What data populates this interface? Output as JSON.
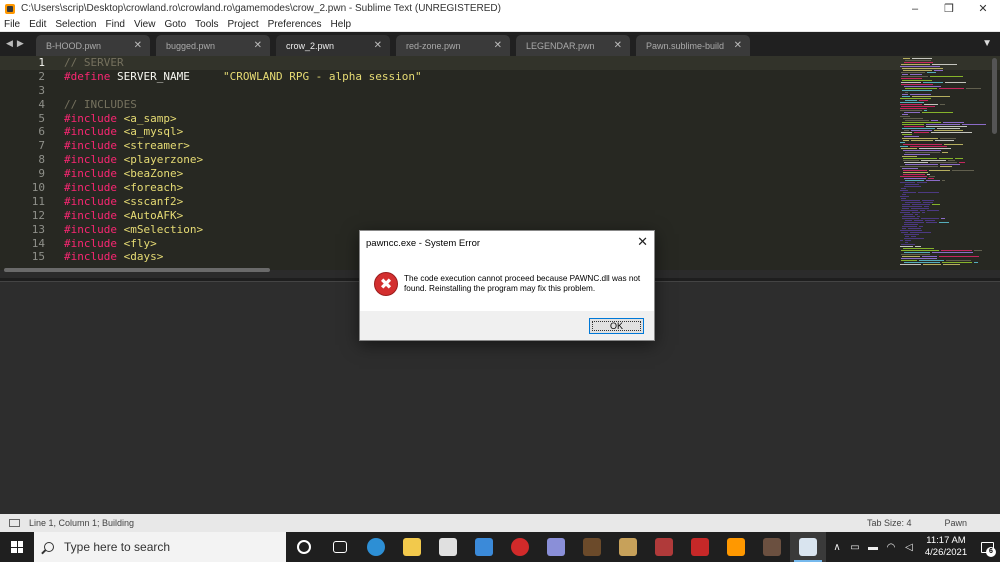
{
  "window": {
    "title": "C:\\Users\\scrip\\Desktop\\crowland.ro\\crowland.ro\\gamemodes\\crow_2.pwn - Sublime Text (UNREGISTERED)",
    "minimize": "–",
    "maximize": "❒",
    "close": "✕"
  },
  "menu": [
    "File",
    "Edit",
    "Selection",
    "Find",
    "View",
    "Goto",
    "Tools",
    "Project",
    "Preferences",
    "Help"
  ],
  "tabs": [
    {
      "label": "B-HOOD.pwn",
      "active": false
    },
    {
      "label": "bugged.pwn",
      "active": false
    },
    {
      "label": "crow_2.pwn",
      "active": true
    },
    {
      "label": "red-zone.pwn",
      "active": false
    },
    {
      "label": "LEGENDAR.pwn",
      "active": false
    },
    {
      "label": "Pawn.sublime-build",
      "active": false
    }
  ],
  "tab_close": "✕",
  "tab_nav": {
    "prev": "◀",
    "next": "▶",
    "dropdown": "▼"
  },
  "editor": {
    "line_numbers": [
      "1",
      "2",
      "3",
      "4",
      "5",
      "6",
      "7",
      "8",
      "9",
      "10",
      "11",
      "12",
      "13",
      "14",
      "15"
    ],
    "lines": [
      {
        "type": "comment",
        "text": "// SERVER"
      },
      {
        "type": "define",
        "kw": "#define",
        "name": " SERVER_NAME",
        "value": "\"CROWLAND RPG - alpha session\""
      },
      {
        "type": "blank",
        "text": ""
      },
      {
        "type": "comment",
        "text": "// INCLUDES"
      },
      {
        "type": "include",
        "kw": "#include",
        "value": "<a_samp>"
      },
      {
        "type": "include",
        "kw": "#include",
        "value": "<a_mysql>"
      },
      {
        "type": "include",
        "kw": "#include",
        "value": "<streamer>"
      },
      {
        "type": "include",
        "kw": "#include",
        "value": "<playerzone>"
      },
      {
        "type": "include",
        "kw": "#include",
        "value": "<beaZone>"
      },
      {
        "type": "include",
        "kw": "#include",
        "value": "<foreach>"
      },
      {
        "type": "include",
        "kw": "#include",
        "value": "<sscanf2>"
      },
      {
        "type": "include",
        "kw": "#include",
        "value": "<AutoAFK>"
      },
      {
        "type": "include",
        "kw": "#include",
        "value": "<mSelection>"
      },
      {
        "type": "include",
        "kw": "#include",
        "value": "<fly>"
      },
      {
        "type": "include",
        "kw": "#include",
        "value": "<days>"
      }
    ]
  },
  "status": {
    "position": "Line 1, Column 1; Building",
    "tab_size": "Tab Size: 4",
    "syntax": "Pawn"
  },
  "dialog": {
    "title": "pawncc.exe - System Error",
    "close": "✕",
    "icon": "✖",
    "message": "The code execution cannot proceed because PAWNC.dll was not found. Reinstalling the program may fix this problem.",
    "ok_label": "OK"
  },
  "taskbar": {
    "search_placeholder": "Type here to search",
    "apps": [
      {
        "name": "cortana-icon",
        "color": "#1f1f1f",
        "active": false
      },
      {
        "name": "task-view-icon",
        "color": "#1f1f1f",
        "active": false
      },
      {
        "name": "edge-icon",
        "color": "#2d8fd5",
        "active": false
      },
      {
        "name": "file-explorer-icon",
        "color": "#f2c94c",
        "active": false
      },
      {
        "name": "store-icon",
        "color": "#e0e0e0",
        "active": false
      },
      {
        "name": "mail-icon",
        "color": "#3b8ad9",
        "active": false
      },
      {
        "name": "opera-icon",
        "color": "#d12a2a",
        "active": false
      },
      {
        "name": "discord-icon",
        "color": "#8a8fd8",
        "active": false
      },
      {
        "name": "game-icon",
        "color": "#6b4a2a",
        "active": false
      },
      {
        "name": "photos-icon",
        "color": "#c7a15a",
        "active": false
      },
      {
        "name": "winrar-icon",
        "color": "#b03a3a",
        "active": false
      },
      {
        "name": "filezilla-icon",
        "color": "#c62828",
        "active": false
      },
      {
        "name": "sublime-icon",
        "color": "#ff9800",
        "active": false
      },
      {
        "name": "game2-icon",
        "color": "#6b5040",
        "active": false
      },
      {
        "name": "console-icon",
        "color": "#d9e4ef",
        "active": true
      }
    ],
    "tray": {
      "chevron": "∧",
      "time": "11:17 AM",
      "date": "4/26/2021",
      "notification_count": "6"
    }
  }
}
